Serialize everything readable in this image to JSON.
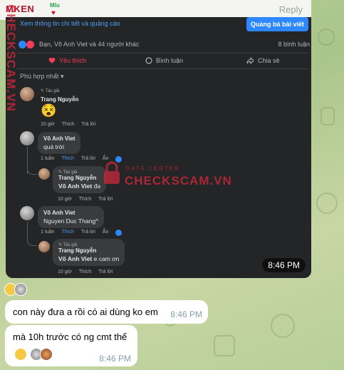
{
  "header": {
    "brand": "MKEN",
    "brand_sub": "Mlu",
    "reply": "Reply"
  },
  "post": {
    "ad_link": "Xem thông tin chi tiết và quảng cáo",
    "promote_button": "Quảng bá bài viết",
    "reactions_text": "Bạn, Võ Anh Viet và 44 người khác",
    "share_count": "8 bình luận",
    "actions": [
      {
        "label": "Yêu thích",
        "icon": "heart-icon"
      },
      {
        "label": "Bình luận",
        "icon": "comment-icon"
      },
      {
        "label": "Chia sẻ",
        "icon": "share-icon"
      }
    ],
    "sort_label": "Phù hợp nhất"
  },
  "comments": [
    {
      "tag": "Tác giả",
      "name": "Trang Nguyễn",
      "text": "😵",
      "meta": [
        "10 giờ",
        "Thích",
        "Trả lời"
      ]
    },
    {
      "name": "Võ Anh Viet",
      "text": "quá trời",
      "meta": [
        "1 tuần",
        "Thích",
        "Trả lời",
        "Ẩn"
      ]
    },
    {
      "tag": "Tác giả",
      "name": "Trang Nguyễn",
      "mention": "Võ Anh Viet",
      "text": "đa",
      "meta": [
        "10 giờ",
        "Thích",
        "Trả lời"
      ]
    },
    {
      "name": "Võ Anh Viet",
      "text": "Nguyen Duc Thang^",
      "meta": [
        "1 tuần",
        "Thích",
        "Trả lời",
        "Ẩn"
      ]
    },
    {
      "tag": "Tác giả",
      "name": "Trang Nguyễn",
      "mention": "Võ Anh Viet",
      "text": "e cam ơn",
      "meta": [
        "10 giờ",
        "Thích",
        "Trả lời"
      ]
    }
  ],
  "photo_time": "8:46 PM",
  "watermark": {
    "vertical": "CHECKSCAM.VN",
    "center_label": "DATA CENTER",
    "center_main": "CHECKSCAM.VN"
  },
  "messages": [
    {
      "text": "con này đưa a rồi có ai dùng ko em",
      "time": "8:46 PM"
    },
    {
      "text": "mà 10h trước có ng cmt thế",
      "time": "8:46 PM"
    }
  ]
}
